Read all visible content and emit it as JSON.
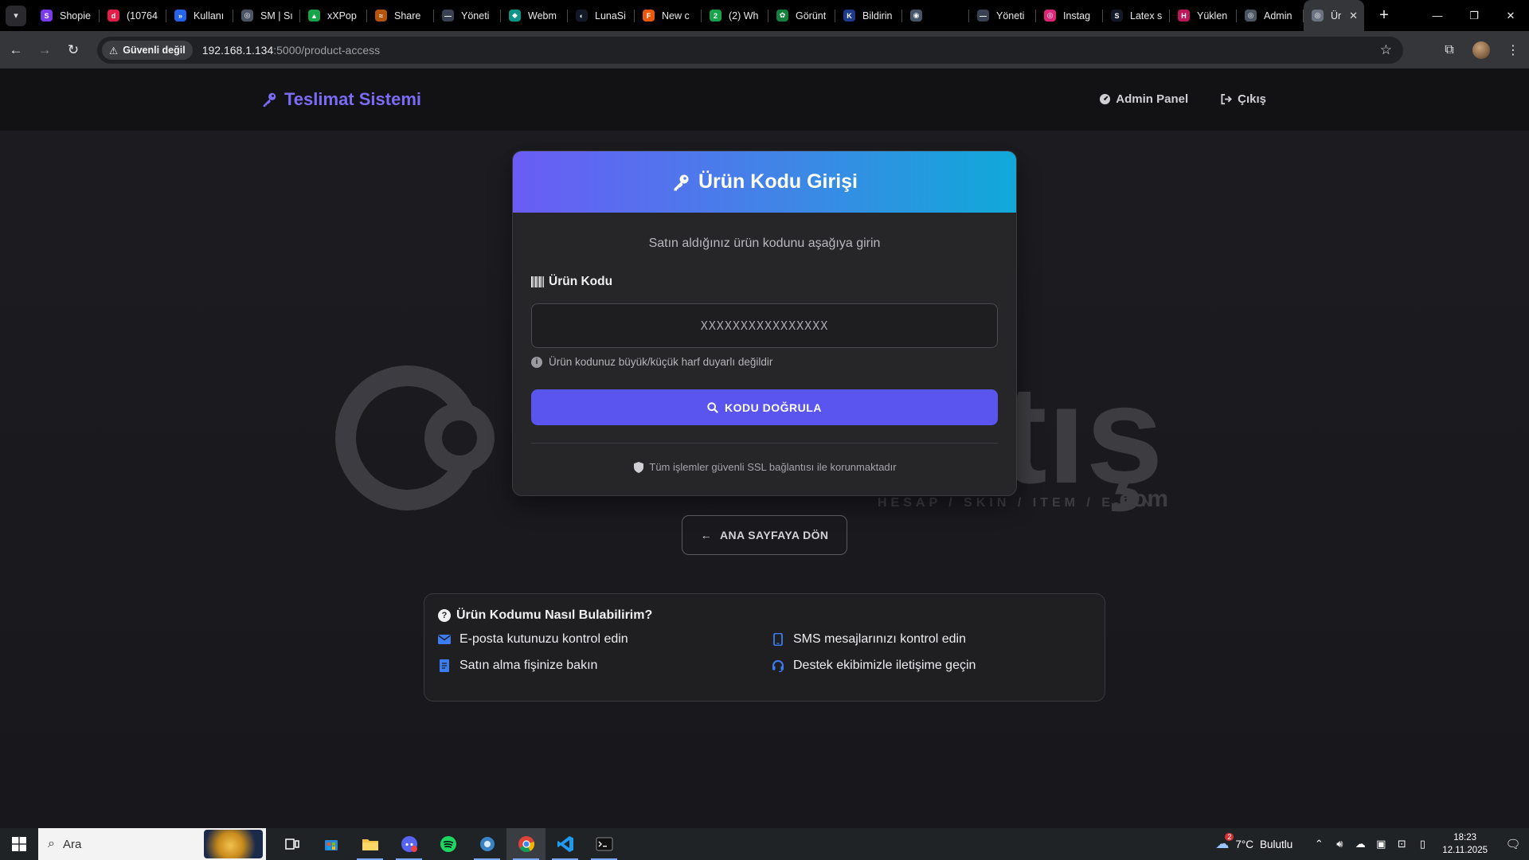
{
  "browser": {
    "tabs": [
      {
        "title": "Shopie",
        "fav_color": "#7c3aed",
        "fav_char": "S"
      },
      {
        "title": "(10764",
        "fav_color": "#e11d48",
        "fav_char": "d"
      },
      {
        "title": "Kullanı",
        "fav_color": "#2563eb",
        "fav_char": "»"
      },
      {
        "title": "SM | Sı",
        "fav_color": "#4b5563",
        "fav_char": "◎"
      },
      {
        "title": "xXPop",
        "fav_color": "#16a34a",
        "fav_char": "▲"
      },
      {
        "title": "Share",
        "fav_color": "#b45309",
        "fav_char": "≈"
      },
      {
        "title": "Yöneti",
        "fav_color": "#374151",
        "fav_char": "—"
      },
      {
        "title": "Webm",
        "fav_color": "#0d9488",
        "fav_char": "◆"
      },
      {
        "title": "LunaSi",
        "fav_color": "#111827",
        "fav_char": "◐"
      },
      {
        "title": "New c",
        "fav_color": "#ea580c",
        "fav_char": "F"
      },
      {
        "title": "(2) Wh",
        "fav_color": "#16a34a",
        "fav_char": "2"
      },
      {
        "title": "Görünt",
        "fav_color": "#15803d",
        "fav_char": "✿"
      },
      {
        "title": "Bildirin",
        "fav_color": "#1e3a8a",
        "fav_char": "K"
      },
      {
        "title": "",
        "fav_color": "#475569",
        "fav_char": "◉"
      },
      {
        "title": "Yöneti",
        "fav_color": "#374151",
        "fav_char": "—"
      },
      {
        "title": "Instag",
        "fav_color": "#db2777",
        "fav_char": "◎"
      },
      {
        "title": "Latex s",
        "fav_color": "#111827",
        "fav_char": "S"
      },
      {
        "title": "Yüklen",
        "fav_color": "#be185d",
        "fav_char": "H"
      },
      {
        "title": "Admin",
        "fav_color": "#4b5563",
        "fav_char": "◎"
      }
    ],
    "active_tab": {
      "title": "Ür",
      "fav_color": "#6b7280",
      "fav_char": "◎"
    },
    "security_chip": "Güvenli değil",
    "url_host": "192.168.1.134",
    "url_path": ":5000/product-access"
  },
  "site": {
    "brand": "Teslimat Sistemi",
    "nav": {
      "admin": "Admin Panel",
      "logout": "Çıkış"
    }
  },
  "card": {
    "title": "Ürün Kodu Girişi",
    "subtitle": "Satın aldığınız ürün kodunu aşağıya girin",
    "field_label": "Ürün Kodu",
    "placeholder": "XXXXXXXXXXXXXXXX",
    "value": "",
    "hint": "Ürün kodunuz büyük/küçük harf duyarlı değildir",
    "verify_button": "KODU DOĞRULA",
    "ssl_note": "Tüm işlemler güvenli SSL bağlantısı ile korunmaktadır"
  },
  "watermark": {
    "brand": "itemsatış",
    "tagline": "HESAP / SKIN / ITEM / E-PIN",
    "domain": ".com"
  },
  "back_button": "ANA SAYFAYA DÖN",
  "help": {
    "title": "Ürün Kodumu Nasıl Bulabilirim?",
    "items": [
      {
        "text": "E-posta kutunuzu kontrol edin",
        "icon": "envelope-icon"
      },
      {
        "text": "SMS mesajlarınızı kontrol edin",
        "icon": "mobile-icon"
      },
      {
        "text": "Satın alma fişinize bakın",
        "icon": "receipt-icon"
      },
      {
        "text": "Destek ekibimizle iletişime geçin",
        "icon": "headset-icon"
      }
    ]
  },
  "taskbar": {
    "search_placeholder": "Ara",
    "weather_temp": "7°C",
    "weather_text": "Bulutlu",
    "weather_badge": "2",
    "time": "18:23",
    "date": "12.11.2025"
  },
  "colors": {
    "accent": "#5b55f0",
    "brand": "#7b6cf6",
    "header_gradient_start": "#6a5cf5",
    "header_gradient_end": "#10a9d9",
    "icon_blue": "#3d7cf0"
  }
}
